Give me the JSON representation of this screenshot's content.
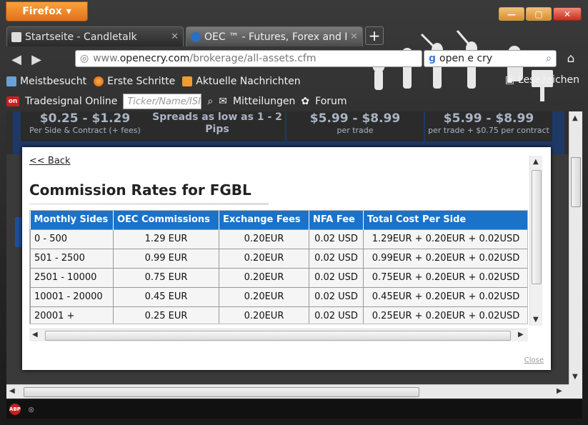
{
  "window": {
    "app_button": "Firefox",
    "minimize": "—",
    "maximize": "▢",
    "close": "✕"
  },
  "tabs": [
    {
      "label": "Startseite - Candletalk",
      "close": "✕"
    },
    {
      "label": "OEC ™ - Futures, Forex and E...",
      "close": "✕"
    }
  ],
  "nav": {
    "url_prefix": "www.",
    "url_domain": "openecry.com",
    "url_path": "/brokerage/all-assets.cfm",
    "search_value": "open e cry"
  },
  "bookmarks": {
    "items": [
      "Meistbesucht",
      "Erste Schritte",
      "Aktuelle Nachrichten"
    ],
    "lesezeichen": "Lesezeichen"
  },
  "toolbar2": {
    "tradesignal": "Tradesignal Online",
    "ticker_placeholder": "Ticker/Name/ISI",
    "mitteilungen": "Mitteilungen",
    "forum": "Forum"
  },
  "banner": [
    {
      "big": "$0.25 - $1.29",
      "small": "Per Side & Contract (+ fees)"
    },
    {
      "big": "Spreads as low as 1 - 2 Pips",
      "small": ""
    },
    {
      "big": "$5.99 - $8.99",
      "small": "per trade"
    },
    {
      "big": "$5.99 - $8.99",
      "small": "per trade + $0.75 per contract"
    }
  ],
  "modal": {
    "back": "<< Back",
    "title": "Commission Rates for FGBL",
    "close": "Close",
    "headers": [
      "Monthly Sides",
      "OEC Commissions",
      "Exchange Fees",
      "NFA Fee",
      "Total Cost Per Side"
    ],
    "rows": [
      [
        "0 - 500",
        "1.29 EUR",
        "0.20EUR",
        "0.02 USD",
        "1.29EUR + 0.20EUR + 0.02USD"
      ],
      [
        "501 - 2500",
        "0.99 EUR",
        "0.20EUR",
        "0.02 USD",
        "0.99EUR + 0.20EUR + 0.02USD"
      ],
      [
        "2501 - 10000",
        "0.75 EUR",
        "0.20EUR",
        "0.02 USD",
        "0.75EUR + 0.20EUR + 0.02USD"
      ],
      [
        "10001 - 20000",
        "0.45 EUR",
        "0.20EUR",
        "0.02 USD",
        "0.45EUR + 0.20EUR + 0.02USD"
      ],
      [
        "20001 +",
        "0.25 EUR",
        "0.20EUR",
        "0.02 USD",
        "0.25EUR + 0.20EUR + 0.02USD"
      ]
    ]
  },
  "status": {
    "abp": "ABP"
  },
  "colors": {
    "header_blue": "#1a72c9",
    "firefox_orange": "#e2721b"
  }
}
